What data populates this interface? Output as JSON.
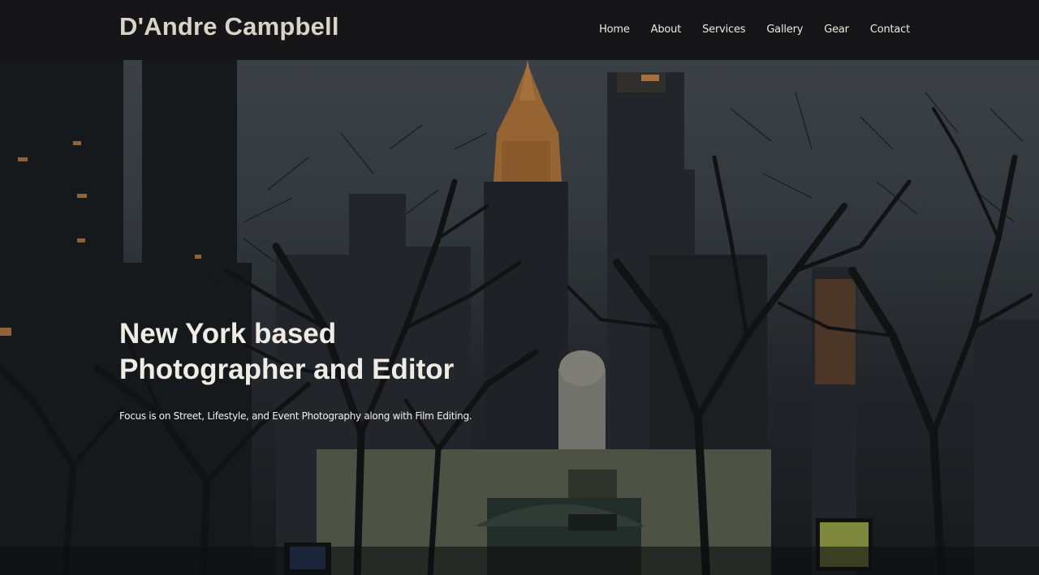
{
  "header": {
    "site_title": "D'Andre Campbell",
    "nav": [
      {
        "label": "Home"
      },
      {
        "label": "About"
      },
      {
        "label": "Services"
      },
      {
        "label": "Gallery"
      },
      {
        "label": "Gear"
      },
      {
        "label": "Contact"
      }
    ]
  },
  "hero": {
    "headline_line1": "New York based",
    "headline_line2": "Photographer and Editor",
    "tagline": "Focus is on Street, Lifestyle, and Event Photography along with Film Editing.",
    "background_image": "city-skyline-dusk-with-bare-trees"
  },
  "colors": {
    "header_bg": "#161618",
    "title_text": "#d9d3c8",
    "nav_text": "#ece8e0",
    "hero_text": "#efece6"
  }
}
